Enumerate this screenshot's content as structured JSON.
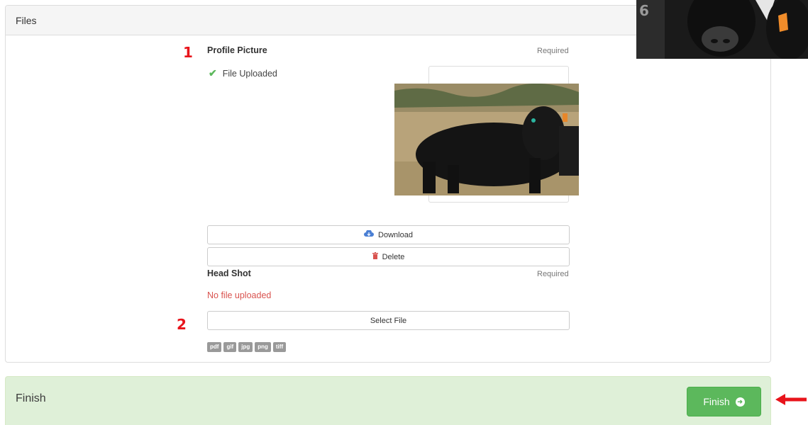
{
  "files_panel": {
    "title": "Files",
    "profile_picture": {
      "label": "Profile Picture",
      "required": "Required",
      "status": "File Uploaded",
      "status_icon": "check-icon",
      "download_label": "Download",
      "download_icon": "cloud-download-icon",
      "delete_label": "Delete",
      "delete_icon": "trash-icon"
    },
    "head_shot": {
      "label": "Head Shot",
      "required": "Required",
      "status": "No file uploaded",
      "select_label": "Select File"
    },
    "file_types": [
      "pdf",
      "gif",
      "jpg",
      "png",
      "tiff"
    ]
  },
  "annotations": {
    "marker_1": "1",
    "marker_2": "2",
    "arrow_icon": "red-left-arrow-icon"
  },
  "finish_panel": {
    "title": "Finish",
    "button_label": "Finish",
    "button_icon": "circle-arrow-right-icon"
  },
  "colors": {
    "success": "#5cb85c",
    "danger": "#d9534f",
    "finish_bg": "#dff0d8",
    "annotation": "#e8141b"
  }
}
